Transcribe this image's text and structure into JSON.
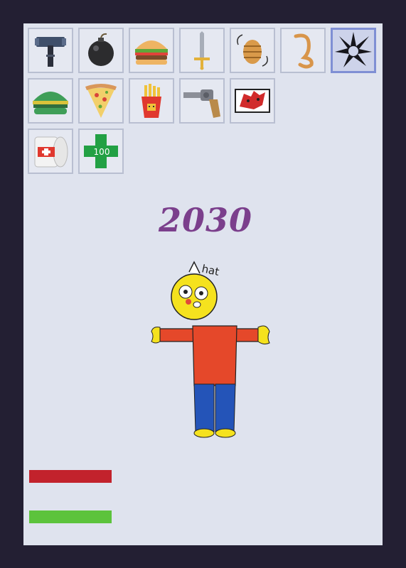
{
  "game": {
    "score": "2030",
    "character_hat_text": "hat",
    "health_fraction": 1.0,
    "stamina_fraction": 1.0,
    "colors": {
      "background": "#231f33",
      "panel": "#dfe3ee",
      "score": "#7b3f8c",
      "health_bar": "#c2222c",
      "stamina_bar": "#5cc33c",
      "selected_slot_border": "#7f8fd4"
    }
  },
  "inventory": {
    "selected_slot": 6,
    "items": [
      {
        "icon": "hammer-icon"
      },
      {
        "icon": "bomb-icon"
      },
      {
        "icon": "burger-icon"
      },
      {
        "icon": "sword-icon"
      },
      {
        "icon": "hive-icon"
      },
      {
        "icon": "hook-icon"
      },
      {
        "icon": "spike-trap-icon"
      },
      {
        "icon": "green-burger-icon"
      },
      {
        "icon": "pizza-slice-icon"
      },
      {
        "icon": "fries-icon"
      },
      {
        "icon": "revolver-icon"
      },
      {
        "icon": "red-creature-icon"
      },
      {
        "icon": "bandage-roll-icon"
      },
      {
        "icon": "health-plus-icon",
        "label": "100"
      }
    ]
  }
}
